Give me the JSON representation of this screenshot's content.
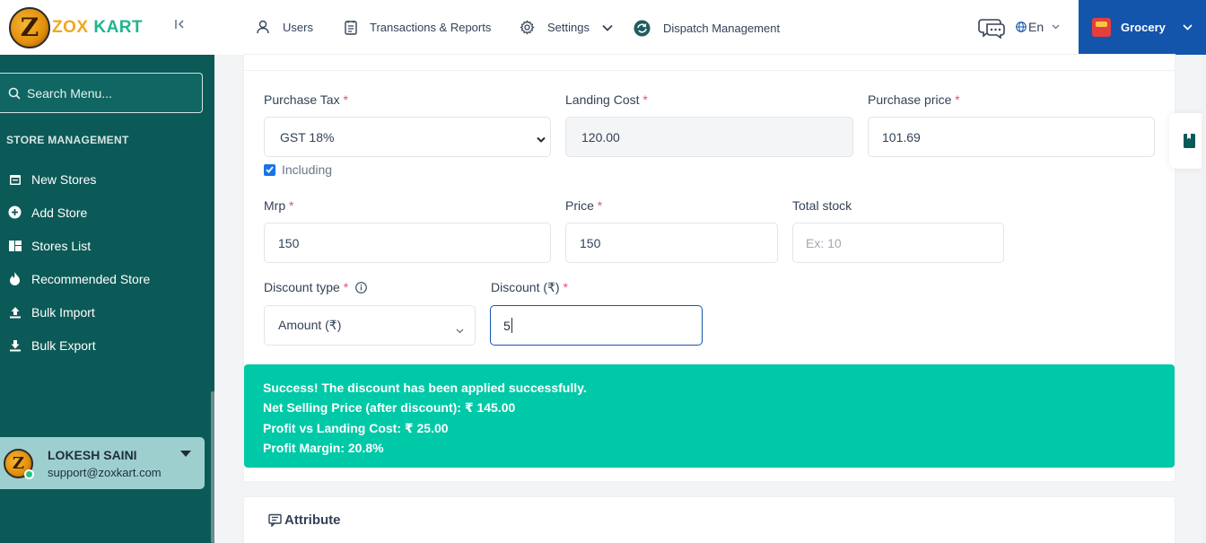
{
  "brand": {
    "name_part1": "ZOX",
    "name_part2": "KART",
    "logo_letter": "Z"
  },
  "sidebar": {
    "search_placeholder": "Search Menu...",
    "section_title": "STORE MANAGEMENT",
    "items": [
      {
        "label": "New Stores",
        "icon": "calendar-icon"
      },
      {
        "label": "Add Store",
        "icon": "plus-circle-icon"
      },
      {
        "label": "Stores List",
        "icon": "grid-icon"
      },
      {
        "label": "Recommended Store",
        "icon": "flame-icon"
      },
      {
        "label": "Bulk Import",
        "icon": "upload-icon"
      },
      {
        "label": "Bulk Export",
        "icon": "download-icon"
      }
    ],
    "user": {
      "name": "LOKESH SAINI",
      "email": "support@zoxkart.com",
      "status": "online"
    }
  },
  "topbar": {
    "links": [
      {
        "label": "Users",
        "icon": "user-icon"
      },
      {
        "label": "Transactions & Reports",
        "icon": "report-icon"
      },
      {
        "label": "Settings",
        "icon": "gear-icon"
      },
      {
        "label": "Dispatch Management",
        "icon": "refresh-icon"
      }
    ],
    "language": "En",
    "module": "Grocery"
  },
  "form": {
    "purchase_tax": {
      "label": "Purchase Tax",
      "value": "GST 18%",
      "including_label": "Including",
      "including_checked": true
    },
    "landing_cost": {
      "label": "Landing Cost",
      "value": "120.00"
    },
    "purchase_price": {
      "label": "Purchase price",
      "value": "101.69"
    },
    "mrp": {
      "label": "Mrp",
      "value": "150"
    },
    "price": {
      "label": "Price",
      "value": "150"
    },
    "total_stock": {
      "label": "Total stock",
      "placeholder": "Ex: 10"
    },
    "discount_type": {
      "label": "Discount type",
      "value": "Amount (₹)"
    },
    "discount": {
      "label": "Discount (₹)",
      "value": "5"
    },
    "required_mark": "*"
  },
  "alert": {
    "line1": "Success! The discount has been applied successfully.",
    "line2": "Net Selling Price (after discount): ₹ 145.00",
    "line3": "Profit vs Landing Cost: ₹ 25.00",
    "line4": "Profit Margin: 20.8%"
  },
  "attribute": {
    "title": "Attribute"
  },
  "colors": {
    "sidebar": "#0c5a57",
    "primary": "#1455ac",
    "success": "#00c9a7"
  }
}
